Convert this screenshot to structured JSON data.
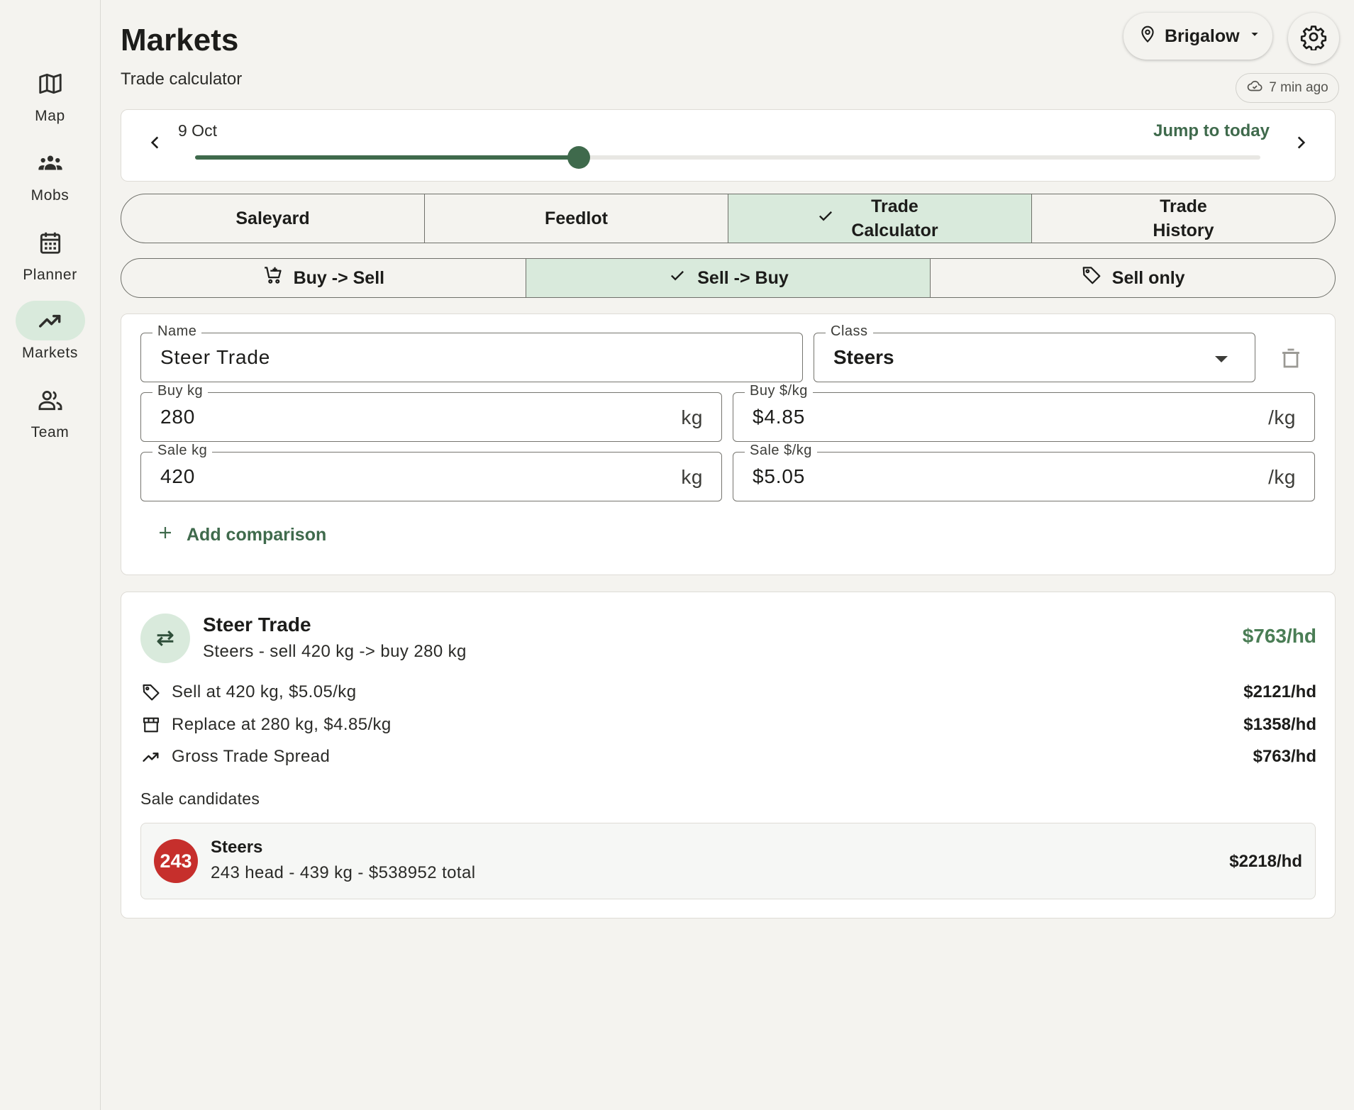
{
  "sidebar": {
    "items": [
      {
        "label": "Map",
        "icon": "map-icon"
      },
      {
        "label": "Mobs",
        "icon": "groups-icon"
      },
      {
        "label": "Planner",
        "icon": "calendar-icon"
      },
      {
        "label": "Markets",
        "icon": "trending-up-icon",
        "active": true
      },
      {
        "label": "Team",
        "icon": "people-icon"
      }
    ]
  },
  "header": {
    "title": "Markets",
    "subtitle": "Trade calculator",
    "location": "Brigalow",
    "sync_status": "7 min ago"
  },
  "date_slider": {
    "date_label": "9 Oct",
    "jump_label": "Jump to today",
    "position_fraction": 0.36
  },
  "tabs": {
    "items": [
      "Saleyard",
      "Feedlot",
      "Trade Calculator",
      "Trade History"
    ],
    "selected": "Trade Calculator"
  },
  "modes": {
    "items": [
      "Buy -> Sell",
      "Sell -> Buy",
      "Sell only"
    ],
    "selected": "Sell -> Buy"
  },
  "form": {
    "name_label": "Name",
    "name_value": "Steer Trade",
    "class_label": "Class",
    "class_value": "Steers",
    "buy_kg_label": "Buy kg",
    "buy_kg_value": "280",
    "buy_kg_suffix": "kg",
    "buy_price_label": "Buy $/kg",
    "buy_price_value": "$4.85",
    "buy_price_suffix": "/kg",
    "sale_kg_label": "Sale kg",
    "sale_kg_value": "420",
    "sale_kg_suffix": "kg",
    "sale_price_label": "Sale $/kg",
    "sale_price_value": "$5.05",
    "sale_price_suffix": "/kg",
    "add_comparison": "Add comparison"
  },
  "result": {
    "title": "Steer Trade",
    "description": "Steers - sell 420 kg -> buy 280 kg",
    "total": "$763/hd",
    "lines": [
      {
        "icon": "tag-icon",
        "label": "Sell at 420 kg, $5.05/kg",
        "value": "$2121/hd"
      },
      {
        "icon": "store-icon",
        "label": "Replace at 280 kg, $4.85/kg",
        "value": "$1358/hd"
      },
      {
        "icon": "trending-up-icon",
        "label": "Gross Trade Spread",
        "value": "$763/hd"
      }
    ],
    "candidates_title": "Sale candidates",
    "candidate": {
      "badge": "243",
      "name": "Steers",
      "description": "243 head - 439 kg - $538952 total",
      "value": "$2218/hd"
    }
  },
  "colors": {
    "accent": "#3f6a4c",
    "accent_light": "#d9eadc",
    "positive": "#4a7d55",
    "badge_red": "#c62f2c",
    "background": "#f4f3ef"
  }
}
